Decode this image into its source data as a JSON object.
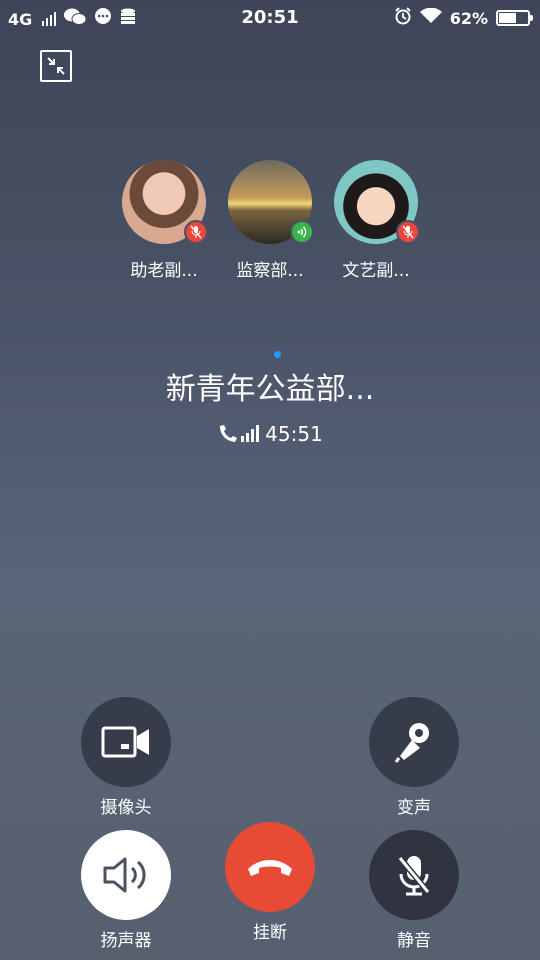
{
  "status_bar": {
    "network": "4G",
    "time": "20:51",
    "battery_percent": "62%",
    "battery_level": 0.62,
    "icons": [
      "signal-icon",
      "wechat-icon",
      "message-icon",
      "storage-icon",
      "alarm-icon",
      "wifi-icon",
      "battery-icon"
    ]
  },
  "minimize": {
    "icon": "minimize-icon"
  },
  "participants": [
    {
      "name": "助老副...",
      "status": "muted"
    },
    {
      "name": "监察部...",
      "status": "speaking"
    },
    {
      "name": "文艺副...",
      "status": "muted"
    }
  ],
  "call": {
    "group_name": "新青年公益部...",
    "duration": "45:51"
  },
  "controls": {
    "camera": "摄像头",
    "voice_change": "变声",
    "speaker": "扬声器",
    "hangup": "挂断",
    "mute": "静音"
  },
  "colors": {
    "hangup": "#e84b35",
    "muted_badge": "#e8483d",
    "speaking_badge": "#3bb54a",
    "accent_dot": "#1ea0f2"
  }
}
